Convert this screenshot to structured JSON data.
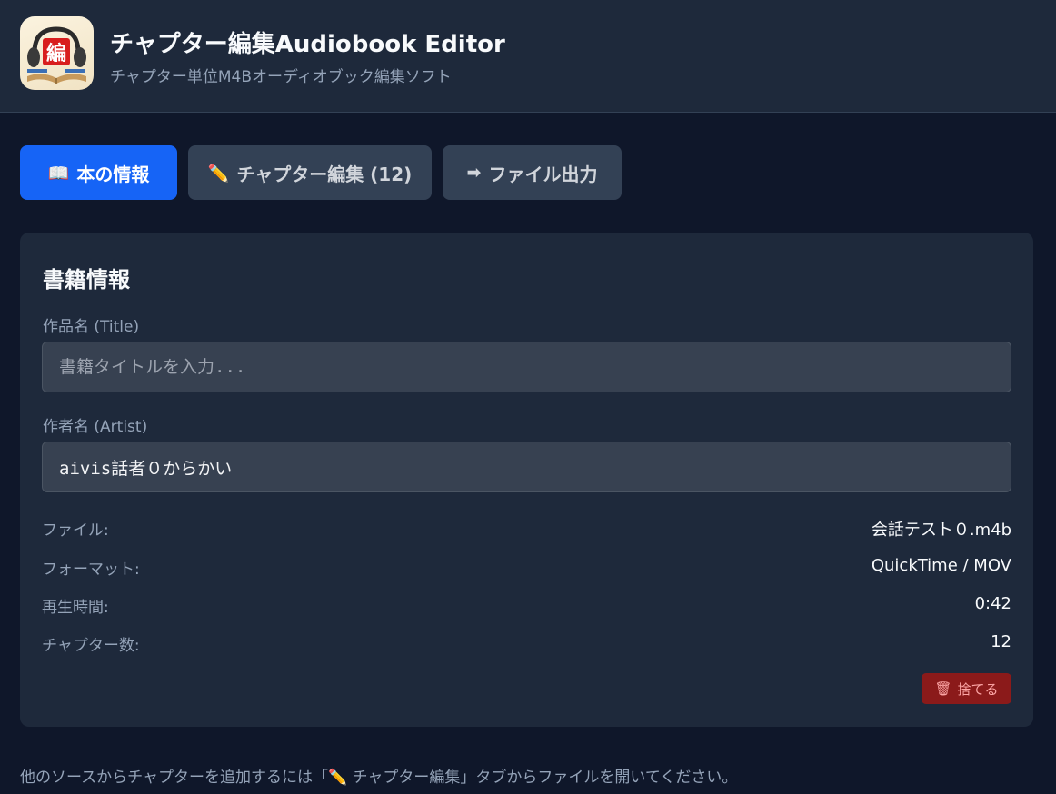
{
  "app": {
    "title": "チャプター編集Audiobook Editor",
    "subtitle": "チャプター単位M4Bオーディオブック編集ソフト",
    "icon_char": "編"
  },
  "tabs": [
    {
      "icon": "📖",
      "label": "本の情報",
      "active": true
    },
    {
      "icon": "✏️",
      "label": "チャプター編集 (12)",
      "active": false
    },
    {
      "icon": "➡",
      "label": "ファイル出力",
      "active": false
    }
  ],
  "book_info": {
    "heading": "書籍情報",
    "title_label": "作品名 (Title)",
    "title_value": "",
    "title_placeholder": "書籍タイトルを入力...",
    "artist_label": "作者名 (Artist)",
    "artist_value": "aivis話者０からかい",
    "rows": [
      {
        "key": "ファイル:",
        "value": "会話テスト０.m4b"
      },
      {
        "key": "フォーマット:",
        "value": "QuickTime / MOV"
      },
      {
        "key": "再生時間:",
        "value": "0:42"
      },
      {
        "key": "チャプター数:",
        "value": "12"
      }
    ],
    "discard_icon": "🗑",
    "discard_label": "捨てる"
  },
  "footer": {
    "note": "他のソースからチャプターを追加するには「✏️ チャプター編集」タブからファイルを開いてください。"
  },
  "colors": {
    "accent": "#1664f6",
    "danger": "#8b1a1a",
    "background": "#0f172a",
    "panel": "#1e293b"
  }
}
